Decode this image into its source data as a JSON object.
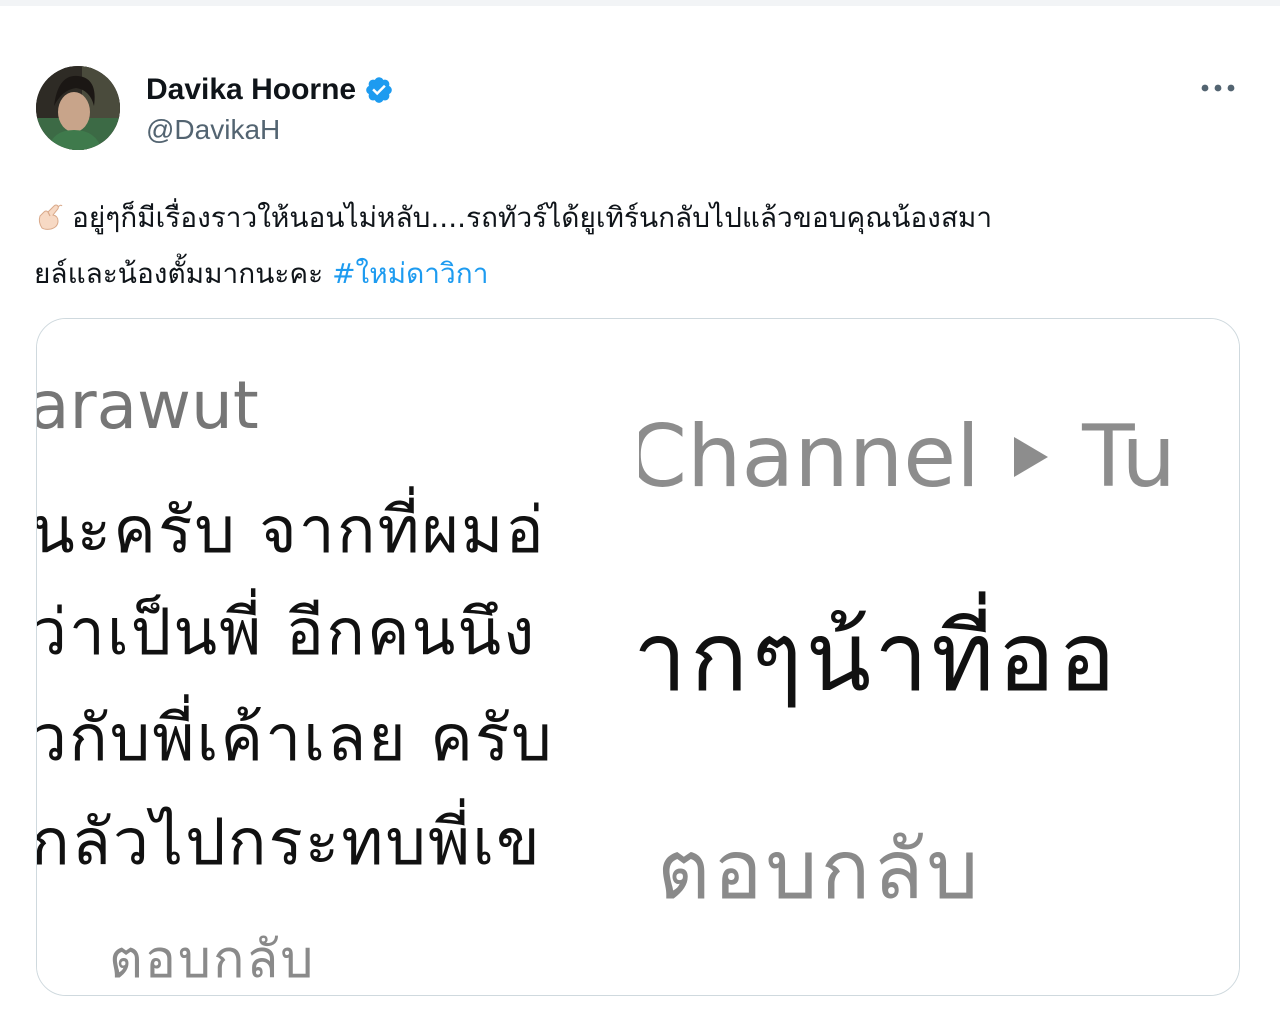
{
  "tweet": {
    "author": {
      "display_name": "Davika Hoorne",
      "handle": "@DavikaH",
      "verified": true
    },
    "text_line1": "อยู่ๆก็มีเรื่องราวให้นอนไม่หลับ....รถทัวร์ได้ยูเทิร์นกลับไปแล้วขอบคุณน้องสมา",
    "text_line2_before": "ยล์และน้องตั้มมากนะคะ",
    "hashtag": "#ใหม่ดาวิกา",
    "leading_emoji": "pinching-hand-emoji",
    "more_icon": "more-options-icon"
  },
  "media": {
    "left_panel": {
      "name_fragment": "arawut",
      "lines": [
        "นะครับ จากที่ผมอ่",
        "ว่าเป็นพี่ อีกคนนึง",
        "วกับพี่เค้าเลย ครับ",
        "กลัวไปกระทบพี่เข"
      ],
      "reply_label": "ตอบกลับ"
    },
    "right_panel": {
      "header_left": "Channel",
      "header_right": "Tu",
      "big_line": "ากๆน้าที่ออ",
      "reply_label": "ตอบกลับ"
    }
  },
  "colors": {
    "hashtag": "#1d9bf0",
    "verified": "#1d9bf0",
    "handle": "#536471",
    "border": "#cfd9de"
  }
}
